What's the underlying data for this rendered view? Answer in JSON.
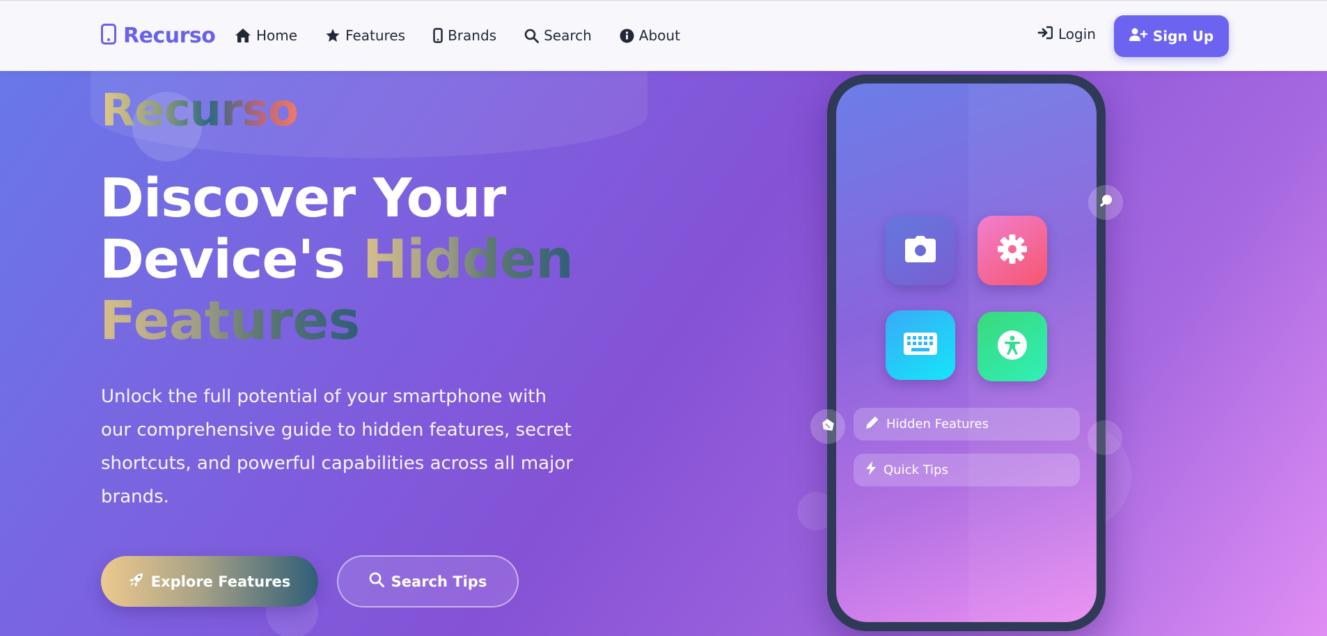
{
  "nav": {
    "brand": "Recurso",
    "brand_icon": "mobile-phone-icon",
    "links": [
      {
        "label": "Home",
        "icon": "home-icon"
      },
      {
        "label": "Features",
        "icon": "star-icon"
      },
      {
        "label": "Brands",
        "icon": "mobile-phone-icon"
      },
      {
        "label": "Search",
        "icon": "search-icon"
      },
      {
        "label": "About",
        "icon": "info-circle-icon"
      }
    ],
    "login": "Login",
    "signup": "Sign Up"
  },
  "hero": {
    "eyebrow": "Recurso",
    "headline_line1": "Discover Your",
    "headline_line2_plain": "Device's ",
    "headline_line2_highlight": "Hidden",
    "headline_line3_highlight": "Features",
    "lead": "Unlock the full potential of your smartphone with our comprehensive guide to hidden features, secret shortcuts, and powerful capabilities across all major brands.",
    "primary_button": "Explore Features",
    "secondary_button": "Search Tips"
  },
  "phone": {
    "apps": [
      {
        "icon": "camera-icon"
      },
      {
        "icon": "gear-icon"
      },
      {
        "icon": "keyboard-icon"
      },
      {
        "icon": "accessibility-icon"
      }
    ],
    "pills": [
      {
        "label": "Hidden Features",
        "icon": "pencil-icon"
      },
      {
        "label": "Quick Tips",
        "icon": "bolt-icon"
      }
    ]
  },
  "colors": {
    "brand": "#6a62e6",
    "signup_bg": "#6c63f0",
    "hero_start": "#6878e8",
    "hero_end": "#e08ef4",
    "phone_frame": "#2f3a56"
  }
}
